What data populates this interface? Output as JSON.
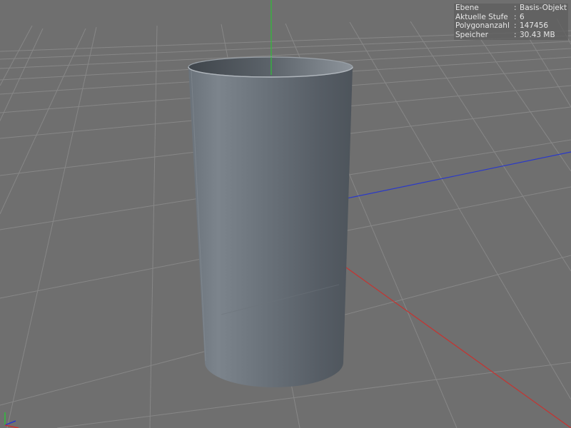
{
  "hud": {
    "rows": [
      {
        "label": "Ebene",
        "value": "Basis-Objekt"
      },
      {
        "label": "Aktuelle Stufe",
        "value": "6"
      },
      {
        "label": "Polygonanzahl",
        "value": "147456"
      },
      {
        "label": "Speicher",
        "value": "30.43 MB"
      }
    ],
    "separator": ":"
  },
  "colors": {
    "background": "#6f6f6f",
    "grid": "#878787",
    "axis_x": "#c8322f",
    "axis_y": "#2fbf3a",
    "axis_z": "#2a39c9",
    "object": "#5f6770"
  }
}
